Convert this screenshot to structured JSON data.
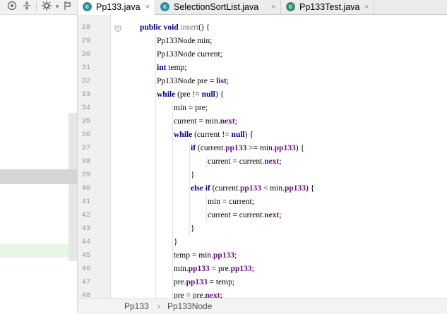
{
  "left_panel": {
    "toolbar_icons": [
      "target-icon",
      "collapse-icon",
      "gear-icon",
      "pin-icon"
    ],
    "selected_row_color": "#d5d5d5",
    "changed_row_color": "#e6f7e6"
  },
  "tabs": [
    {
      "label": "Pp133.java",
      "icon": "java-class-icon",
      "active": true
    },
    {
      "label": "SelectionSortList.java",
      "icon": "java-class-icon",
      "active": false
    },
    {
      "label": "Pp133Test.java",
      "icon": "java-test-class-icon",
      "active": false
    }
  ],
  "tab_close_glyph": "×",
  "editor": {
    "line_numbers": [
      "28",
      "29",
      "30",
      "31",
      "32",
      "33",
      "34",
      "35",
      "36",
      "37",
      "38",
      "39",
      "40",
      "41",
      "42",
      "43",
      "44",
      "45",
      "46",
      "47",
      "48"
    ],
    "lines": [
      {
        "indent": 1,
        "tokens": [
          [
            "kw",
            "public"
          ],
          [
            "",
            " "
          ],
          [
            "kw",
            "void"
          ],
          [
            "",
            " "
          ],
          [
            "fn",
            "insert"
          ],
          [
            "",
            "() {"
          ]
        ]
      },
      {
        "indent": 2,
        "tokens": [
          [
            "",
            "Pp133Node min;"
          ]
        ]
      },
      {
        "indent": 2,
        "tokens": [
          [
            "",
            "Pp133Node current;"
          ]
        ]
      },
      {
        "indent": 2,
        "tokens": [
          [
            "kw",
            "int"
          ],
          [
            "",
            " temp;"
          ]
        ]
      },
      {
        "indent": 2,
        "tokens": [
          [
            "",
            "Pp133Node pre = "
          ],
          [
            "field",
            "list"
          ],
          [
            "",
            ";"
          ]
        ]
      },
      {
        "indent": 2,
        "tokens": [
          [
            "kw",
            "while"
          ],
          [
            "",
            " (pre != "
          ],
          [
            "kw",
            "null"
          ],
          [
            "",
            ") {"
          ]
        ]
      },
      {
        "indent": 3,
        "tokens": [
          [
            "",
            "min = pre;"
          ]
        ]
      },
      {
        "indent": 3,
        "tokens": [
          [
            "",
            "current = min."
          ],
          [
            "field",
            "next"
          ],
          [
            "",
            ";"
          ]
        ]
      },
      {
        "indent": 3,
        "tokens": [
          [
            "kw",
            "while"
          ],
          [
            "",
            " (current != "
          ],
          [
            "kw",
            "null"
          ],
          [
            "",
            ") {"
          ]
        ]
      },
      {
        "indent": 4,
        "tokens": [
          [
            "kw",
            "if"
          ],
          [
            "",
            " (current."
          ],
          [
            "field",
            "pp133"
          ],
          [
            "",
            " >= min."
          ],
          [
            "field",
            "pp133"
          ],
          [
            "",
            ") {"
          ]
        ]
      },
      {
        "indent": 5,
        "tokens": [
          [
            "",
            "current = current."
          ],
          [
            "field",
            "next"
          ],
          [
            "",
            ";"
          ]
        ]
      },
      {
        "indent": 4,
        "tokens": [
          [
            "",
            "}"
          ]
        ]
      },
      {
        "indent": 4,
        "tokens": [
          [
            "kw",
            "else if"
          ],
          [
            "",
            " (current."
          ],
          [
            "field",
            "pp133"
          ],
          [
            "",
            " < min."
          ],
          [
            "field",
            "pp133"
          ],
          [
            "",
            ") {"
          ]
        ]
      },
      {
        "indent": 5,
        "tokens": [
          [
            "",
            "min = current;"
          ]
        ]
      },
      {
        "indent": 5,
        "tokens": [
          [
            "",
            "current = current."
          ],
          [
            "field",
            "next"
          ],
          [
            "",
            ";"
          ]
        ]
      },
      {
        "indent": 4,
        "tokens": [
          [
            "",
            "}"
          ]
        ]
      },
      {
        "indent": 3,
        "tokens": [
          [
            "",
            "}"
          ]
        ]
      },
      {
        "indent": 3,
        "tokens": [
          [
            "",
            "temp = min."
          ],
          [
            "field",
            "pp133"
          ],
          [
            "",
            ";"
          ]
        ]
      },
      {
        "indent": 3,
        "tokens": [
          [
            "",
            "min."
          ],
          [
            "field",
            "pp133"
          ],
          [
            "",
            " = pre."
          ],
          [
            "field",
            "pp133"
          ],
          [
            "",
            ";"
          ]
        ]
      },
      {
        "indent": 3,
        "tokens": [
          [
            "",
            "pre."
          ],
          [
            "field",
            "pp133"
          ],
          [
            "",
            " = temp;"
          ]
        ]
      },
      {
        "indent": 3,
        "tokens": [
          [
            "",
            "pre = pre."
          ],
          [
            "field",
            "next"
          ],
          [
            "",
            ";"
          ]
        ]
      }
    ]
  },
  "breadcrumb": {
    "items": [
      "Pp133",
      "Pp133Node"
    ],
    "separator": "›"
  },
  "colors": {
    "keyword": "#000080",
    "field": "#660e7a",
    "class_icon": "#2f8f9e",
    "test_icon": "#3a8c6e"
  }
}
